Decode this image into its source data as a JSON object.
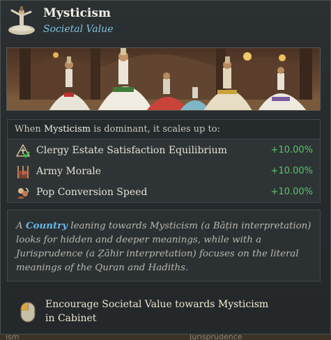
{
  "header": {
    "title": "Mysticism",
    "subtitle": "Societal Value",
    "icon": "whirling-dervish-icon"
  },
  "illustration": {
    "subject": "whirling dervishes"
  },
  "dominant": {
    "prefix": "When ",
    "value_name": "Mysticism",
    "suffix": " is dominant, it scales up to:",
    "modifiers": [
      {
        "icon": "clergy-estate-icon",
        "label": "Clergy Estate Satisfaction Equilibrium",
        "value": "+10.00%"
      },
      {
        "icon": "army-morale-icon",
        "label": "Army Morale",
        "value": "+10.00%"
      },
      {
        "icon": "pop-conversion-icon",
        "label": "Pop Conversion Speed",
        "value": "+10.00%"
      }
    ],
    "positive_color": "#5cc26a"
  },
  "description": {
    "pre": "A ",
    "country": "Country",
    "post": " leaning towards Mysticism (a Bāṭin interpretation) looks for hidden and deeper meanings, while with a Jurisprudence (a Ẓāhir interpretation) focuses on the literal meanings of the Quran and Hadiths."
  },
  "footer": {
    "icon": "mouse-left-click-icon",
    "pre": "Encourage Societal Value towards ",
    "highlight": "Mysticism",
    "post": " in Cabinet"
  },
  "behind": {
    "left": "ism",
    "right": "Jurisprudence"
  }
}
